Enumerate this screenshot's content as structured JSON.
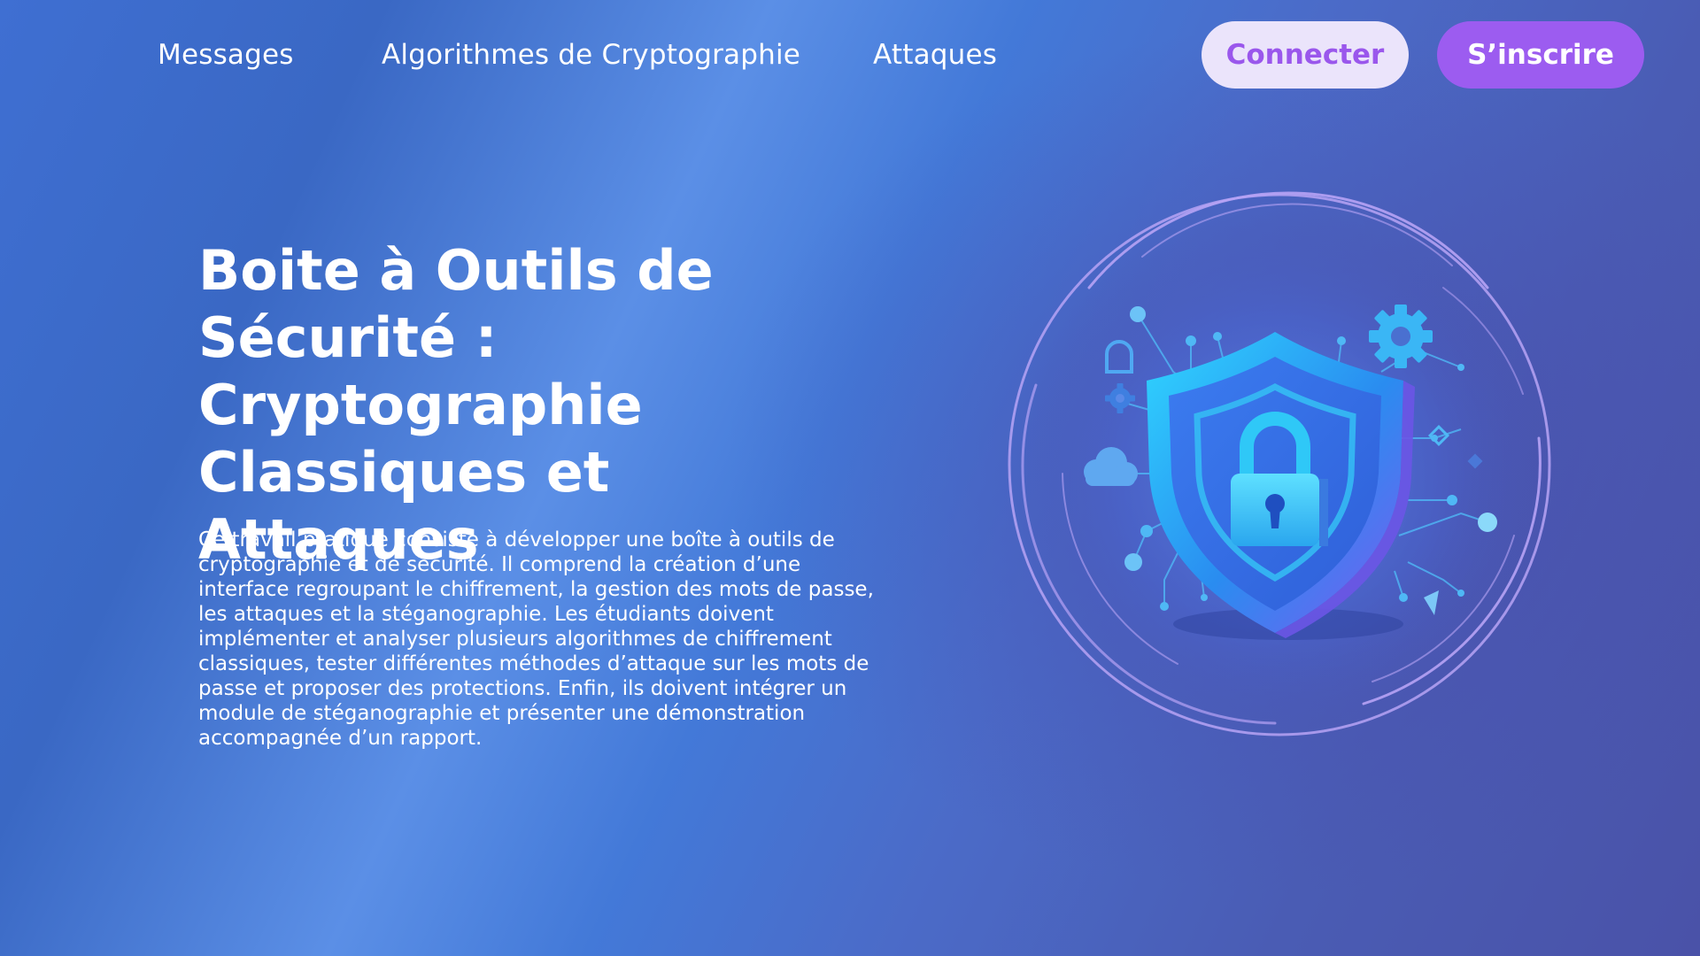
{
  "nav": {
    "links": [
      {
        "label": "Messages"
      },
      {
        "label": "Algorithmes de Cryptographie"
      },
      {
        "label": "Attaques"
      }
    ],
    "login_label": "Connecter",
    "signup_label": "S’inscrire"
  },
  "hero": {
    "title": "Boite à Outils de Sécurité : Cryptographie Classiques et Attaques",
    "description": "Ce travail pratique consiste à développer une boîte à outils de cryptographie et de sécurité. Il comprend la création d’une interface regroupant le chiffrement, la gestion des mots de passe, les attaques et la stéganographie. Les étudiants doivent implémenter et analyser plusieurs algorithmes de chiffrement classiques, tester différentes méthodes d’attaque sur les mots de passe et proposer des protections. Enfin, ils doivent intégrer un module de stéganographie et présenter une démonstration accompagnée d’un rapport."
  },
  "illustration": {
    "icon": "shield-lock-icon"
  },
  "colors": {
    "accent": "#9c5cf0",
    "accent_light": "#ebe4fb",
    "shield_cyan": "#26c6f5",
    "ring": "#b49cf2"
  }
}
